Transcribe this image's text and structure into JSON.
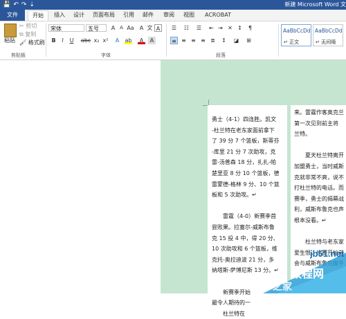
{
  "window": {
    "title": "新建 Microsoft Word 文"
  },
  "qat": {
    "save": "💾",
    "undo": "↶",
    "redo": "↷",
    "more": "⇣"
  },
  "tabs": [
    "插入",
    "设计",
    "页面布局",
    "引用",
    "邮件",
    "审阅",
    "视图",
    "ACROBAT"
  ],
  "tab_file": "文件",
  "tab_home": "开始",
  "clipboard": {
    "paste": "粘贴",
    "cut": "剪切",
    "copy": "复制",
    "format_painter": "格式刷",
    "label": "剪贴板"
  },
  "font": {
    "name": "宋体",
    "size": "五号",
    "label": "字体"
  },
  "paragraph": {
    "label": "段落"
  },
  "styles": [
    {
      "sample": "AaBbCcDd",
      "name": "↵ 正文"
    },
    {
      "sample": "AaBbCcDd",
      "name": "↵ 无间隔"
    }
  ],
  "doc_left": [
    "勇士（4-1）四连胜。凯文",
    "-杜兰特在老东家面前拿下",
    "了 39 分 7 个篮板，斯蒂芬",
    "-库里 21 分 7 次助攻，克",
    "雷-汤普森 18 分，扎扎-帕",
    "楚里亚 8 分 10 个篮板，德",
    "雷蒙德-格林 9 分、10 个篮",
    "板和 5 次助攻。↵",
    "",
    "　　雷霆（4-0）新赛季首",
    "尝败果。拉塞尔-威斯布鲁",
    "克 15 投 4 中，得 20 分、",
    "10 次助攻和 6 个篮板，维",
    "克托-奥拉迪波 21 分，多",
    "纳塔斯-萨博尼斯 13 分。↵",
    "",
    "　　新赛季开始",
    "最令人期待的一",
    "　　杜兰特在"
  ],
  "doc_right": [
    "来。雷霆作客奥克兰",
    "第一次见到前主将",
    "兰特。",
    "",
    "　　夏天杜兰特离开",
    "加盟勇士，当时威斯",
    "克就非常不爽，说不",
    "打杜兰特的电话。而",
    "赛季，勇士的揭幕战",
    "利，威斯布鲁克也声",
    "根本没看。↵",
    "",
    "　　杜兰特与老东家",
    "爱生恨，比赛开始前",
    "会与威斯布鲁克握手"
  ],
  "watermark": {
    "text1": "jb51.net",
    "text2": "教程网",
    "text3": "脚本之家"
  }
}
